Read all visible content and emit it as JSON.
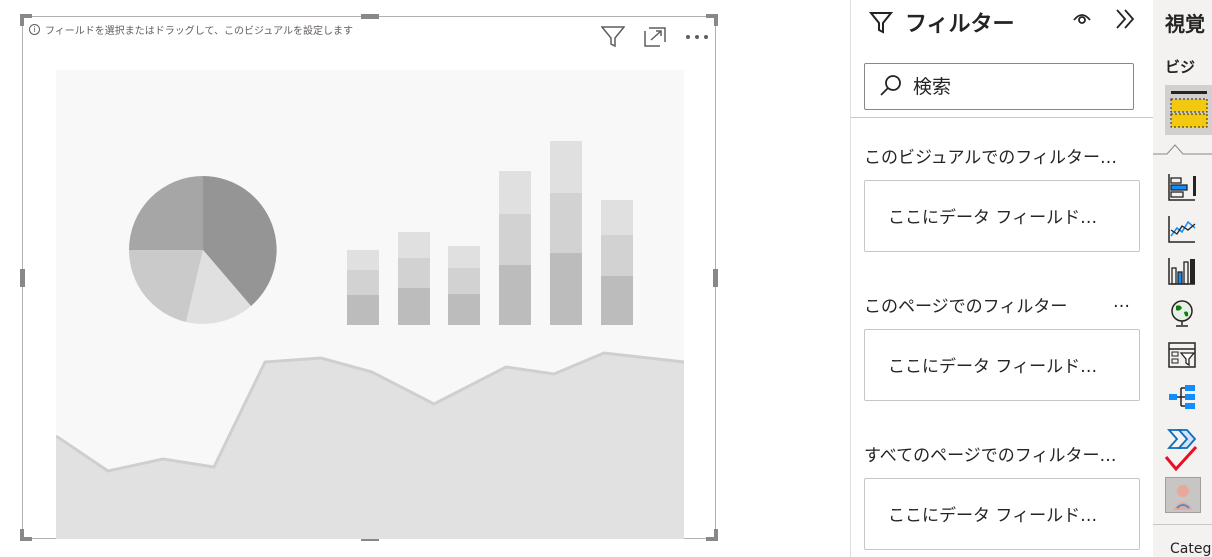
{
  "visual": {
    "hint_text": "フィールドを選択またはドラッグして、このビジュアルを設定します",
    "info_glyph": "i",
    "tools": [
      "filter-icon",
      "focus-mode-icon",
      "more-options-icon"
    ],
    "more_label": "···"
  },
  "filters_pane": {
    "title": "フィルター",
    "search": {
      "placeholder": "検索"
    },
    "sections": [
      {
        "label": "このビジュアルでのフィルター…",
        "well_text": "ここにデータ フィールド…"
      },
      {
        "label": "このページでのフィルター",
        "more": "…",
        "well_text": "ここにデータ フィールド…"
      },
      {
        "label": "すべてのページでのフィルター…",
        "well_text": "ここにデータ フィールド…"
      }
    ]
  },
  "visualizations_pane": {
    "title": "視覚",
    "subtitle": "ビジ",
    "icons": [
      "stacked-bar-icon",
      "line-chart-icon",
      "ribbon-chart-icon",
      "globe-map-icon",
      "slicer-filter-icon",
      "decomposition-tree-icon",
      "power-automate-icon",
      "custom-visual-icon"
    ],
    "bottom_label": "Categ",
    "accent": "#e81123"
  },
  "colors": {
    "placeholder_fill": "#e1e1e1",
    "placeholder_dark": "#959595",
    "pane_bg": "#f3f2f1",
    "selected_yellow": "#f2c811"
  }
}
